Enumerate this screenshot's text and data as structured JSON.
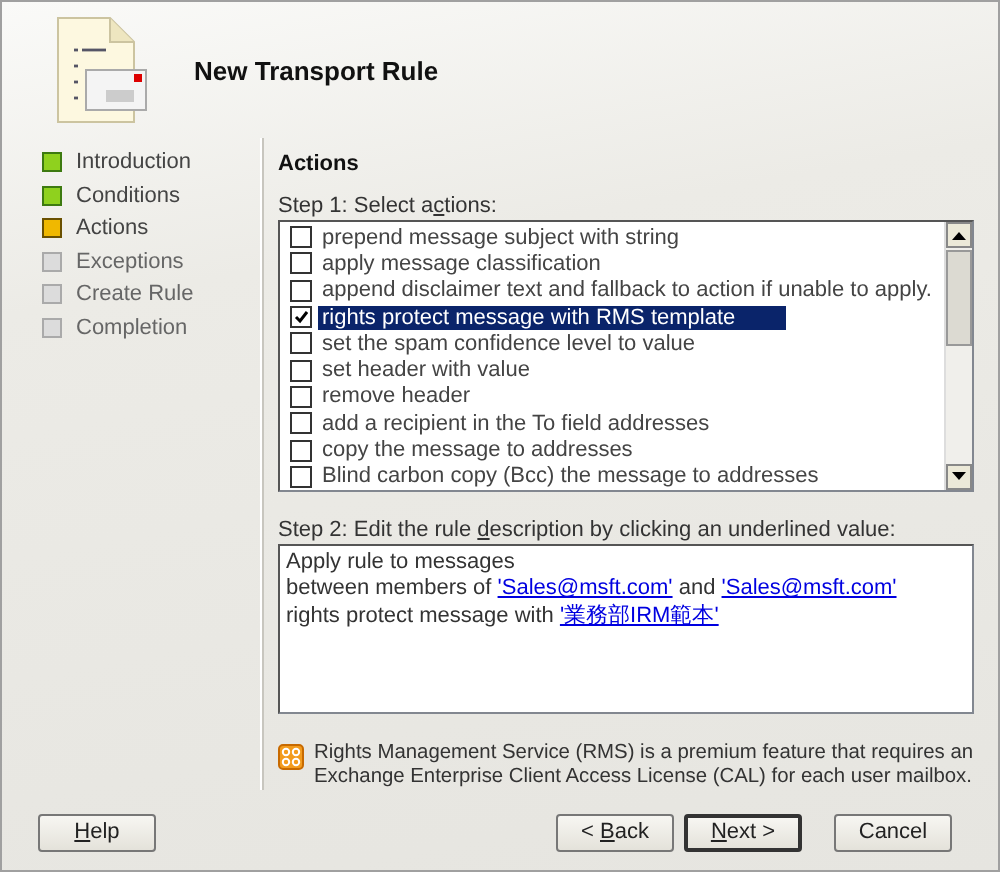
{
  "window": {
    "title": "New Transport Rule"
  },
  "steps": [
    {
      "label": "Introduction",
      "completed": true,
      "current": false
    },
    {
      "label": "Conditions",
      "completed": true,
      "current": false
    },
    {
      "label": "Actions",
      "completed": false,
      "current": true
    },
    {
      "label": "Exceptions",
      "completed": false,
      "current": false
    },
    {
      "label": "Create Rule",
      "completed": false,
      "current": false
    },
    {
      "label": "Completion",
      "completed": false,
      "current": false
    }
  ],
  "page": {
    "heading": "Actions",
    "step1_label": {
      "pre": "Step 1: Select a",
      "key": "c",
      "post": "tions:"
    },
    "actions": [
      {
        "label": "prepend message subject with string",
        "checked": false,
        "selected": false
      },
      {
        "label": "apply message classification",
        "checked": false,
        "selected": false
      },
      {
        "label": "append disclaimer text and fallback to action if unable to apply.",
        "checked": false,
        "selected": false
      },
      {
        "label": "rights protect message with RMS template",
        "checked": true,
        "selected": true
      },
      {
        "label": "set the spam confidence level to value",
        "checked": false,
        "selected": false
      },
      {
        "label": "set header with value",
        "checked": false,
        "selected": false
      },
      {
        "label": "remove header",
        "checked": false,
        "selected": false
      },
      {
        "label": "add a recipient in the To field addresses",
        "checked": false,
        "selected": false
      },
      {
        "label": "copy the message to addresses",
        "checked": false,
        "selected": false
      },
      {
        "label": "Blind carbon copy (Bcc) the message to addresses",
        "checked": false,
        "selected": false
      }
    ],
    "step2_label": {
      "pre": "Step 2: Edit the rule ",
      "key": "d",
      "post": "escription by clicking an underlined value:"
    },
    "description": [
      [
        {
          "kind": "text",
          "text": "Apply rule to messages"
        }
      ],
      [
        {
          "kind": "text",
          "text": "between members of"
        },
        {
          "kind": "link",
          "text": "'Sales@msft.com'"
        },
        {
          "kind": "text",
          "text": "and"
        },
        {
          "kind": "link",
          "text": "'Sales@msft.com'"
        }
      ],
      [
        {
          "kind": "text",
          "text": "rights protect message with"
        },
        {
          "kind": "link",
          "text": "'業務部IRM範本'"
        }
      ]
    ],
    "note": "Rights Management Service (RMS) is a premium feature that requires an Exchange Enterprise Client Access License (CAL) for each user mailbox."
  },
  "buttons": {
    "help": {
      "key": "H",
      "post": "elp"
    },
    "actions": [
      {
        "pre": "< ",
        "key": "B",
        "post": "ack",
        "default": false
      },
      {
        "key": "N",
        "post": "ext >",
        "default": true
      },
      {
        "pre": "Cancel",
        "default": false
      }
    ]
  }
}
